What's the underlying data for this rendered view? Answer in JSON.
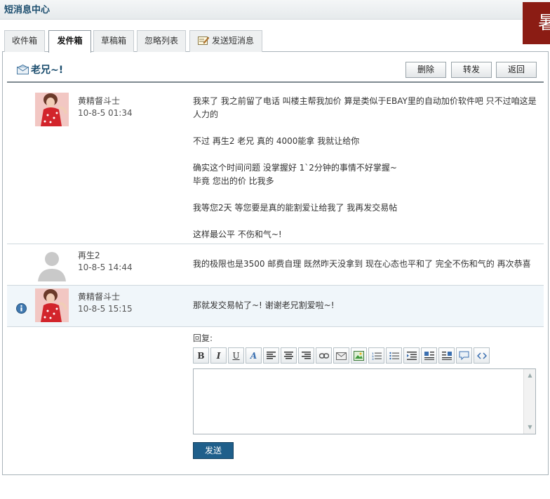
{
  "header": {
    "title": "短消息中心",
    "corner_text": "暑"
  },
  "tabs": [
    {
      "label": "收件箱"
    },
    {
      "label": "发件箱"
    },
    {
      "label": "草稿箱"
    },
    {
      "label": "忽略列表"
    },
    {
      "label": "发送短消息"
    }
  ],
  "active_tab": "发件箱",
  "thread": {
    "subject": "老兄~!",
    "actions": {
      "delete": "删除",
      "forward": "转发",
      "back": "返回"
    }
  },
  "messages": [
    {
      "sender": "黄精督斗士",
      "time": "10-8-5 01:34",
      "text": "我来了 我之前留了电话 叫楼主帮我加价 算是类似于EBAY里的自动加价软件吧 只不过咱这是人力的\n\n不过 再生2 老兄 真的 4000能拿 我就让给你\n\n确实这个时间问题 没掌握好 1`2分钟的事情不好掌握~\n毕竟 您出的价 比我多\n\n我等您2天 等您要是真的能割爱让给我了 我再发交易帖\n\n这样最公平 不伤和气~!"
    },
    {
      "sender": "再生2",
      "time": "10-8-5 14:44",
      "text": "我的极限也是3500 邮费自理 既然昨天没拿到 现在心态也平和了 完全不伤和气的 再次恭喜"
    },
    {
      "sender": "黄精督斗士",
      "time": "10-8-5 15:15",
      "text": "那就发交易帖了~! 谢谢老兄割爱啦~!"
    }
  ],
  "reply": {
    "label": "回复:",
    "value": "",
    "toolbar": [
      "B",
      "I",
      "U",
      "A",
      "align-left-icon",
      "align-center-icon",
      "align-right-icon",
      "link-icon",
      "email-icon",
      "image-icon",
      "ordered-list-icon",
      "unordered-list-icon",
      "indent-icon",
      "float-left-icon",
      "float-right-icon",
      "quote-icon",
      "code-icon"
    ],
    "send_label": "发送"
  },
  "colors": {
    "title": "#1b4d6e",
    "send_button": "#1f5f8b",
    "highlight_row": "#f0f6fa",
    "corner_badge": "#8b1c14"
  }
}
